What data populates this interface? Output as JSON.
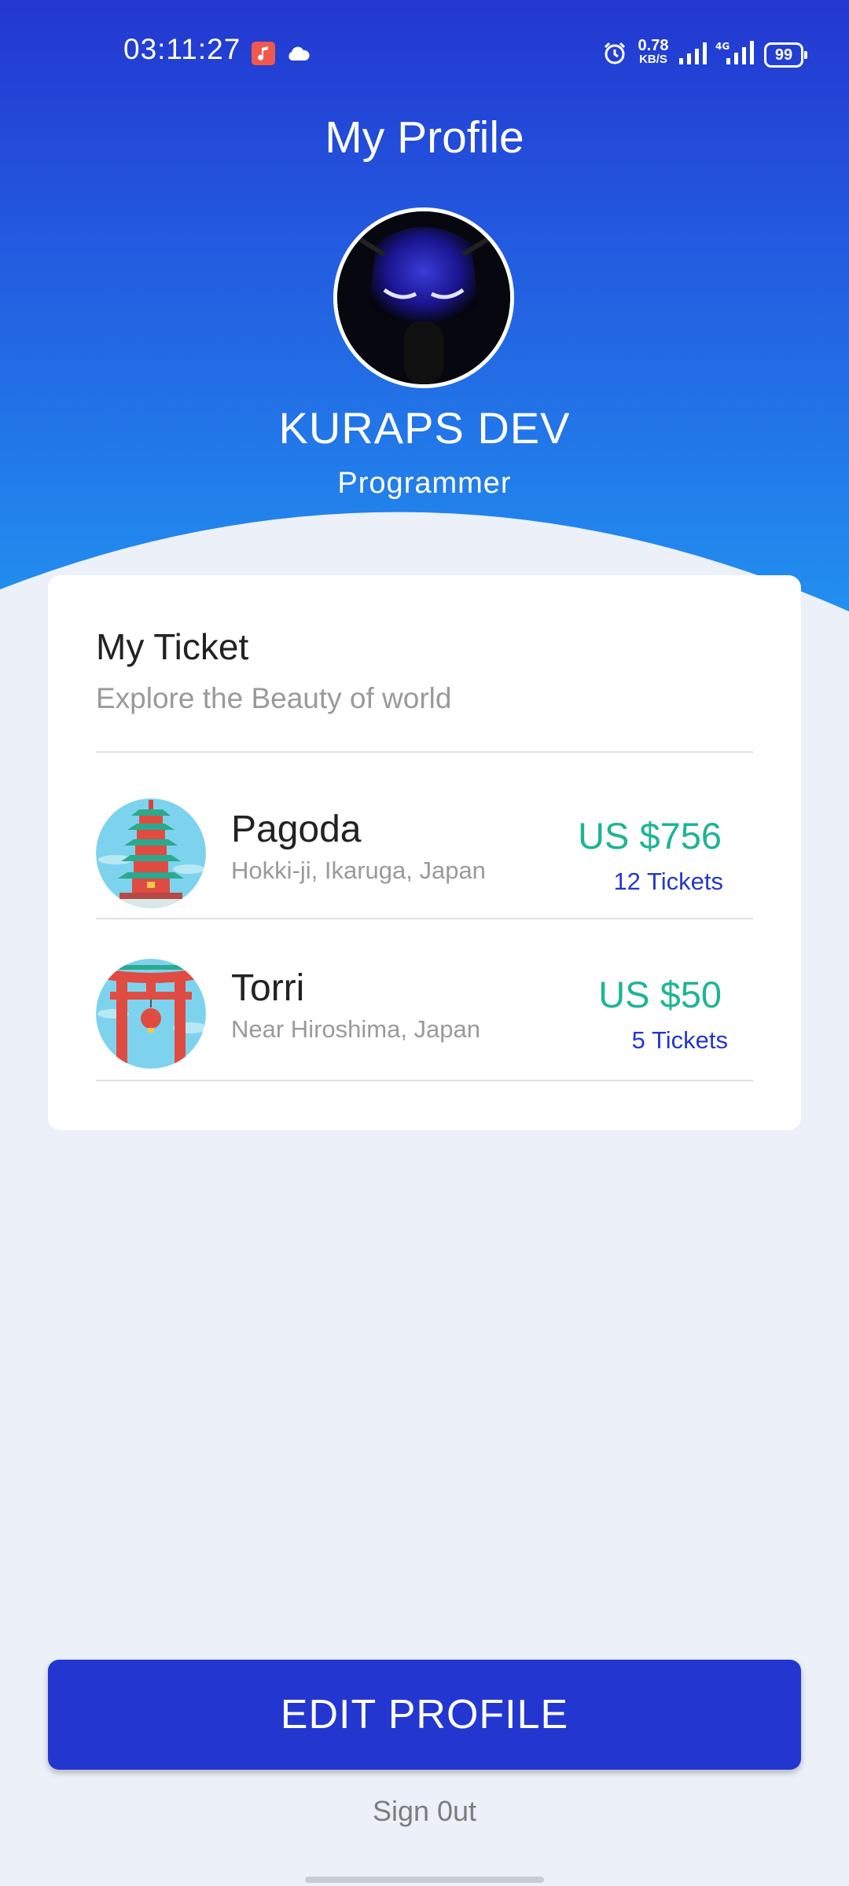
{
  "status_bar": {
    "time": "03:11:27",
    "net_speed_value": "0.78",
    "net_speed_unit": "KB/S",
    "battery": "99",
    "icons": [
      "music-notification-icon",
      "cloud-icon",
      "alarm-icon",
      "signal-icon",
      "4g-signal-icon",
      "battery-icon"
    ]
  },
  "header": {
    "title": "My Profile"
  },
  "profile": {
    "name": "KURAPS DEV",
    "role": "Programmer",
    "avatar_icon": "motorcycle-avatar"
  },
  "tickets_card": {
    "title": "My Ticket",
    "subtitle": "Explore the Beauty of world",
    "items": [
      {
        "name": "Pagoda",
        "location": "Hokki-ji, Ikaruga, Japan",
        "price": "US $756",
        "count": "12 Tickets",
        "icon": "pagoda-icon"
      },
      {
        "name": "Torri",
        "location": "Near Hiroshima, Japan",
        "price": "US $50",
        "count": "5 Tickets",
        "icon": "torii-gate-icon"
      }
    ]
  },
  "actions": {
    "edit_label": "EDIT PROFILE",
    "signout_label": "Sign 0ut"
  },
  "colors": {
    "primary": "#2337D0",
    "price": "#1EB594",
    "background": "#ECF0F8"
  }
}
